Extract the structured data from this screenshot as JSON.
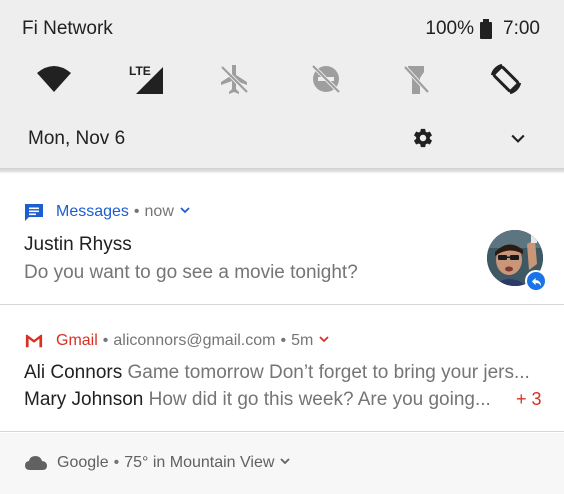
{
  "status_bar": {
    "carrier": "Fi Network",
    "battery_text": "100%",
    "time": "7:00",
    "battery_icon": "battery-full-icon"
  },
  "quick_settings": {
    "tiles": [
      {
        "icon": "wifi-icon",
        "state": "on"
      },
      {
        "icon": "lte-signal-icon",
        "label": "LTE",
        "state": "on"
      },
      {
        "icon": "airplane-mode-icon",
        "state": "off"
      },
      {
        "icon": "do-not-disturb-icon",
        "state": "off"
      },
      {
        "icon": "flashlight-icon",
        "state": "off"
      },
      {
        "icon": "auto-rotate-icon",
        "state": "on"
      }
    ]
  },
  "date_row": {
    "date": "Mon, Nov 6",
    "settings_icon": "gear-icon",
    "expand_icon": "chevron-down-icon"
  },
  "notifications": {
    "messages": {
      "app_name": "Messages",
      "separator": "•",
      "time": "now",
      "title": "Justin Rhyss",
      "text": "Do you want to go see a movie tonight?",
      "accent": "#1a5ed0"
    },
    "gmail": {
      "app_name": "Gmail",
      "separator": "•",
      "account": "aliconnors@gmail.com",
      "separator2": "•",
      "time": "5m",
      "accent": "#d93025",
      "lines": [
        {
          "sender": "Ali Connors",
          "snippet": "Game tomorrow Don’t forget to bring your jers..."
        },
        {
          "sender": "Mary Johnson",
          "snippet": "How did it go this week? Are you going..."
        }
      ],
      "more_count": "+ 3"
    },
    "weather": {
      "app_name": "Google",
      "separator": "•",
      "text": "75° in Mountain View"
    }
  }
}
